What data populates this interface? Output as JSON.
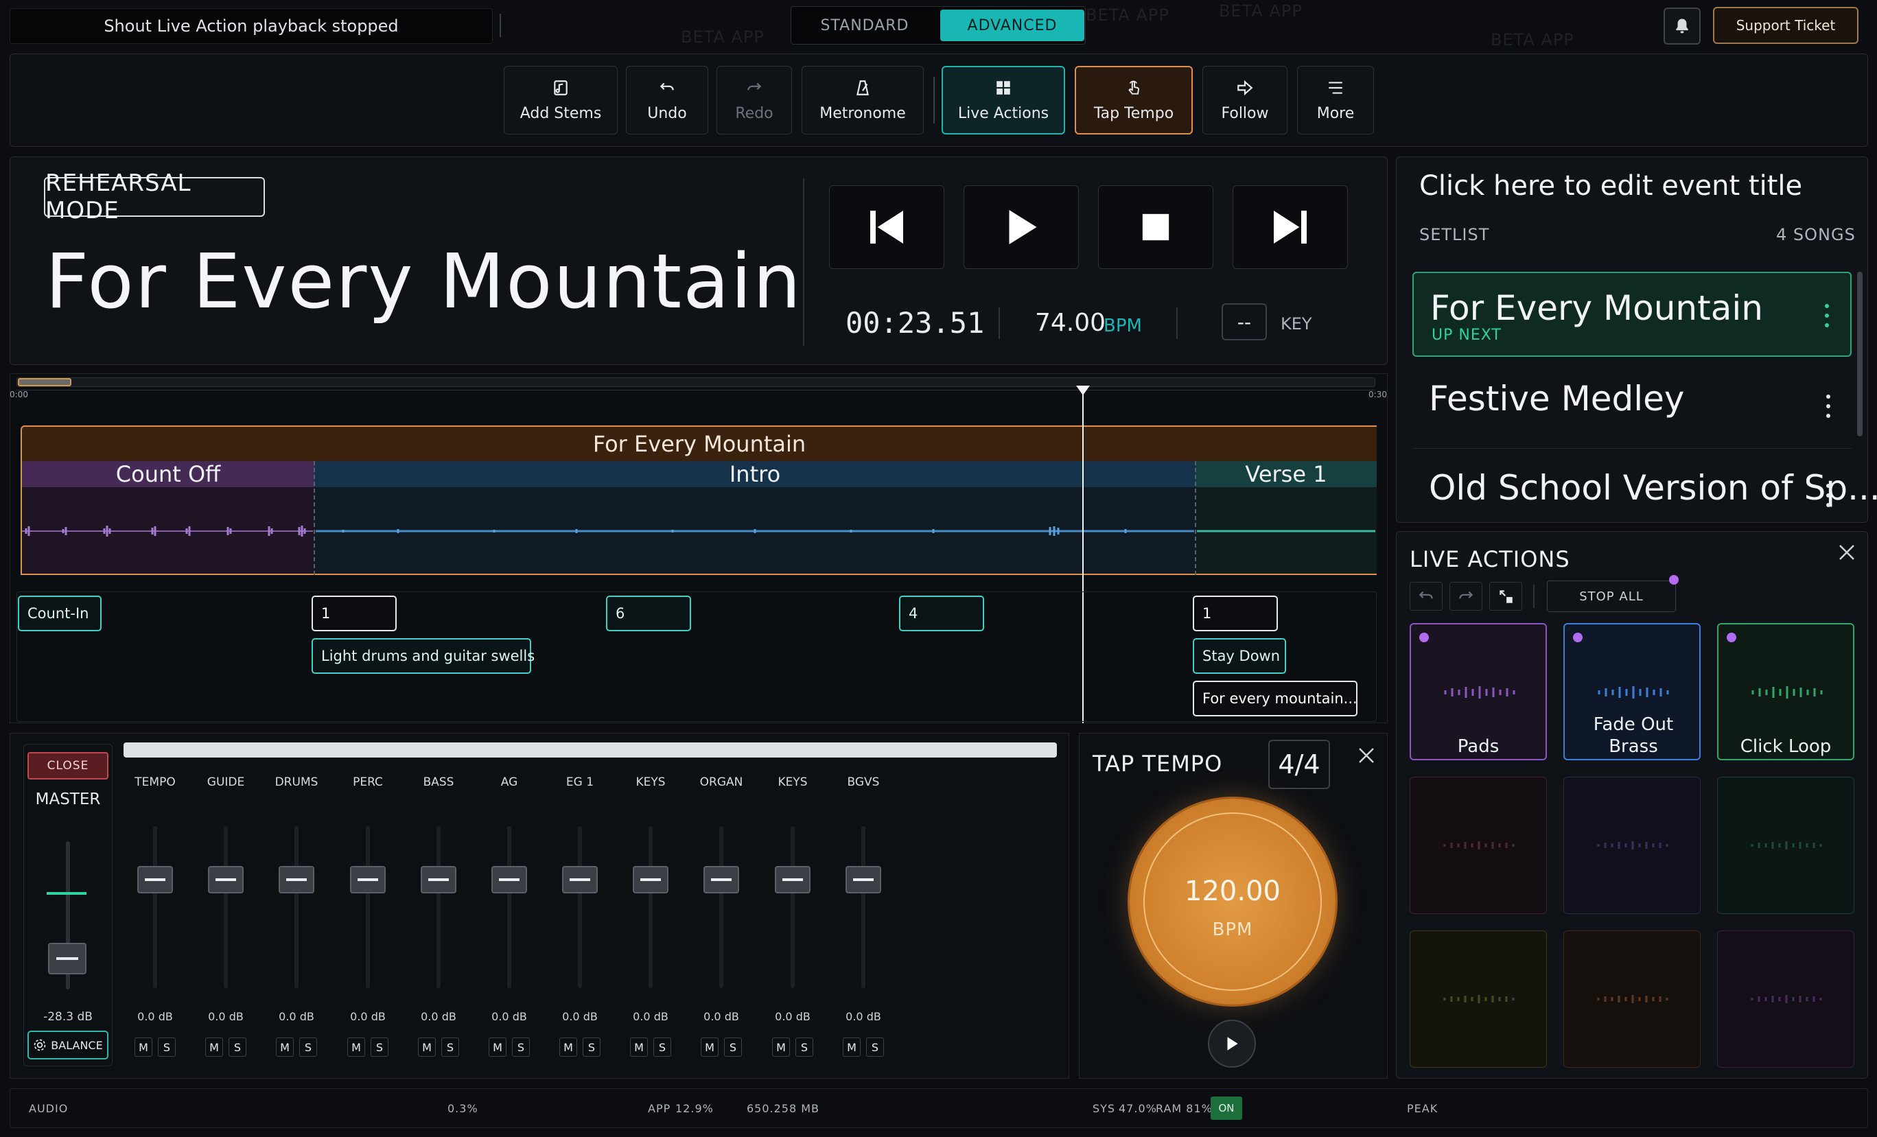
{
  "topbar": {
    "status_message": "Shout Live Action playback stopped",
    "mode_standard": "STANDARD",
    "mode_advanced": "ADVANCED",
    "support_label": "Support Ticket",
    "watermark": "BETA APP"
  },
  "toolbar": {
    "add_stems": "Add Stems",
    "undo": "Undo",
    "redo": "Redo",
    "metronome": "Metronome",
    "live_actions": "Live Actions",
    "tap_tempo": "Tap Tempo",
    "follow": "Follow",
    "more": "More"
  },
  "song": {
    "mode_badge": "REHEARSAL MODE",
    "title": "For Every Mountain",
    "time": "00:23.51",
    "bpm": "74.00",
    "bpm_unit": "BPM",
    "key_value": "--",
    "key_label": "KEY"
  },
  "timeline": {
    "start_label": "0:00",
    "end_label": "0:30",
    "song_bar": "For Every Mountain",
    "sections": [
      "Count Off",
      "Intro",
      "Verse 1"
    ],
    "cues": {
      "count_in": "Count-In",
      "m1": "1",
      "m6": "6",
      "m4": "4",
      "m1b": "1",
      "light_drums": "Light drums and guitar swells",
      "stay_down": "Stay Down",
      "lyric": "For every mountain..."
    }
  },
  "mixer": {
    "close_label": "CLOSE",
    "master_label": "MASTER",
    "master_db": "-28.3 dB",
    "balance_label": "BALANCE",
    "mute_label": "M",
    "solo_label": "S",
    "channels": [
      {
        "name": "TEMPO",
        "db": "0.0 dB"
      },
      {
        "name": "GUIDE",
        "db": "0.0 dB"
      },
      {
        "name": "DRUMS",
        "db": "0.0 dB"
      },
      {
        "name": "PERC",
        "db": "0.0 dB"
      },
      {
        "name": "BASS",
        "db": "0.0 dB"
      },
      {
        "name": "AG",
        "db": "0.0 dB"
      },
      {
        "name": "EG 1",
        "db": "0.0 dB"
      },
      {
        "name": "KEYS",
        "db": "0.0 dB"
      },
      {
        "name": "ORGAN",
        "db": "0.0 dB"
      },
      {
        "name": "KEYS",
        "db": "0.0 dB"
      },
      {
        "name": "BGVS",
        "db": "0.0 dB"
      }
    ]
  },
  "tap_tempo": {
    "title": "TAP TEMPO",
    "signature": "4/4",
    "bpm": "120.00",
    "unit": "BPM"
  },
  "setlist": {
    "event_title": "Click here to edit event title",
    "label": "SETLIST",
    "count": "4 SONGS",
    "items": [
      {
        "title": "For Every Mountain",
        "sub": "UP NEXT"
      },
      {
        "title": "Festive Medley",
        "sub": ""
      },
      {
        "title": "Old School Version of Sp...",
        "sub": ""
      }
    ]
  },
  "live_actions": {
    "title": "LIVE ACTIONS",
    "stop_all": "STOP ALL",
    "pads": [
      {
        "label": "Pads",
        "color": "#b36cf0"
      },
      {
        "label": "Fade Out Brass",
        "color": "#3d7fd8"
      },
      {
        "label": "Click Loop",
        "color": "#2fa86a"
      }
    ]
  },
  "status_bar": {
    "audio_label": "AUDIO",
    "audio_value": "0.3%",
    "app_label": "APP",
    "app_cpu": "12.9%",
    "app_mem": "650.258 MB",
    "sys_label": "SYS",
    "sys_cpu": "47.0%",
    "ram_label": "RAM 81%",
    "on_label": "ON",
    "peak_label": "PEAK"
  },
  "colors": {
    "accent_teal": "#19b7b4",
    "accent_orange": "#e0904a",
    "live_dot": "#b36cf0"
  }
}
